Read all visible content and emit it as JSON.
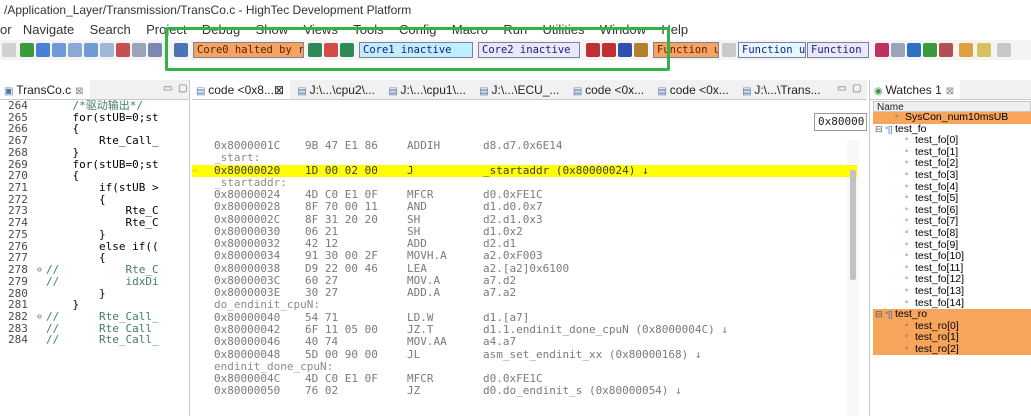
{
  "window": {
    "title": "/Application_Layer/Transmission/TransCo.c - HighTec Development Platform"
  },
  "menu": [
    "or",
    "Navigate",
    "Search",
    "Project",
    "Debug",
    "Show",
    "Views",
    "Tools",
    "Config",
    "Macro",
    "Run",
    "Utilities",
    "Window",
    "Help"
  ],
  "toolbar": {
    "core0": "Core0 halted by re",
    "core1": "Core1 inactive",
    "core2": "Core2 inactive",
    "func1": "Function u",
    "func2": "Function u",
    "func3": "Function u"
  },
  "left_editor": {
    "tab": "TransCo.c",
    "tab_close": "⊠",
    "lines": [
      {
        "n": "264",
        "m": "",
        "c": "    /*驱动输出*/",
        "comment": true
      },
      {
        "n": "265",
        "m": "",
        "c": "    for(stUB=0;st",
        "comment": false
      },
      {
        "n": "266",
        "m": "",
        "c": "    {",
        "comment": false
      },
      {
        "n": "267",
        "m": "",
        "c": "        Rte_Call_",
        "comment": false
      },
      {
        "n": "268",
        "m": "",
        "c": "    }",
        "comment": false
      },
      {
        "n": "269",
        "m": "",
        "c": "    for(stUB=0;st",
        "comment": false
      },
      {
        "n": "270",
        "m": "",
        "c": "    {",
        "comment": false
      },
      {
        "n": "271",
        "m": "",
        "c": "        if(stUB >",
        "comment": false
      },
      {
        "n": "272",
        "m": "",
        "c": "        {",
        "comment": false
      },
      {
        "n": "273",
        "m": "",
        "c": "            Rte_C",
        "comment": false
      },
      {
        "n": "274",
        "m": "",
        "c": "            Rte_C",
        "comment": false
      },
      {
        "n": "275",
        "m": "",
        "c": "        }",
        "comment": false
      },
      {
        "n": "276",
        "m": "",
        "c": "        else if((",
        "comment": false
      },
      {
        "n": "277",
        "m": "",
        "c": "        {",
        "comment": false
      },
      {
        "n": "278",
        "m": "⊖",
        "c": "//          Rte_C",
        "comment": true
      },
      {
        "n": "279",
        "m": "",
        "c": "//          idxDi",
        "comment": true
      },
      {
        "n": "280",
        "m": "",
        "c": "        }",
        "comment": false
      },
      {
        "n": "281",
        "m": "",
        "c": "    }",
        "comment": false
      },
      {
        "n": "282",
        "m": "⊖",
        "c": "//      Rte_Call_",
        "comment": true
      },
      {
        "n": "283",
        "m": "",
        "c": "//      Rte_Call_",
        "comment": true
      },
      {
        "n": "284",
        "m": "",
        "c": "//      Rte_Call_",
        "comment": true
      }
    ]
  },
  "center": {
    "tabs": [
      "code <0x8...",
      "J:\\...\\cpu2\\...",
      "J:\\...\\cpu1\\...",
      "J:\\...\\ECU_...",
      "code <0x...",
      "code <0x...",
      "J:\\...\\Trans..."
    ],
    "address_value": "0x80000",
    "rows": [
      {
        "kind": "ins",
        "a": "0x8000001C",
        "b": "9B 47 E1 86",
        "m": "ADDIH",
        "o": "d8.d7.0x6E14"
      },
      {
        "kind": "label",
        "t": "_start:"
      },
      {
        "kind": "ins",
        "a": "0x80000020",
        "b": "1D 00 02 00",
        "m": "J",
        "o": "_startaddr (0x80000024) ↓",
        "hl": true,
        "g": "⇨"
      },
      {
        "kind": "label",
        "t": "_startaddr:"
      },
      {
        "kind": "ins",
        "a": "0x80000024",
        "b": "4D C0 E1 0F",
        "m": "MFCR",
        "o": "d0.0xFE1C"
      },
      {
        "kind": "ins",
        "a": "0x80000028",
        "b": "8F 70 00 11",
        "m": "AND",
        "o": "d1.d0.0x7"
      },
      {
        "kind": "ins",
        "a": "0x8000002C",
        "b": "8F 31 20 20",
        "m": "SH",
        "o": "d2.d1.0x3"
      },
      {
        "kind": "ins",
        "a": "0x80000030",
        "b": "06 21",
        "m": "SH",
        "o": "d1.0x2"
      },
      {
        "kind": "ins",
        "a": "0x80000032",
        "b": "42 12",
        "m": "ADD",
        "o": "d2.d1"
      },
      {
        "kind": "ins",
        "a": "0x80000034",
        "b": "91 30 00 2F",
        "m": "MOVH.A",
        "o": "a2.0xF003"
      },
      {
        "kind": "ins",
        "a": "0x80000038",
        "b": "D9 22 00 46",
        "m": "LEA",
        "o": "a2.[a2]0x6100"
      },
      {
        "kind": "ins",
        "a": "0x8000003C",
        "b": "60 27",
        "m": "MOV.A",
        "o": "a7.d2"
      },
      {
        "kind": "ins",
        "a": "0x8000003E",
        "b": "30 27",
        "m": "ADD.A",
        "o": "a7.a2"
      },
      {
        "kind": "label",
        "t": "do_endinit_cpuN:"
      },
      {
        "kind": "ins",
        "a": "0x80000040",
        "b": "54 71",
        "m": "LD.W",
        "o": "d1.[a7]"
      },
      {
        "kind": "ins",
        "a": "0x80000042",
        "b": "6F 11 05 00",
        "m": "JZ.T",
        "o": "d1.1.endinit_done_cpuN (0x8000004C) ↓"
      },
      {
        "kind": "ins",
        "a": "0x80000046",
        "b": "40 74",
        "m": "MOV.AA",
        "o": "a4.a7"
      },
      {
        "kind": "ins",
        "a": "0x80000048",
        "b": "5D 00 90 00",
        "m": "JL",
        "o": "asm_set_endinit_xx (0x80000168) ↓"
      },
      {
        "kind": "label",
        "t": "endinit_done_cpuN:"
      },
      {
        "kind": "ins",
        "a": "0x8000004C",
        "b": "4D C0 E1 0F",
        "m": "MFCR",
        "o": "d0.0xFE1C"
      },
      {
        "kind": "ins",
        "a": "0x80000050",
        "b": "76 02",
        "m": "JZ",
        "o": "d0.do_endinit_s (0x80000054) ↓"
      }
    ]
  },
  "watches": {
    "tab": "Watches 1",
    "header": "Name",
    "rows": [
      {
        "t": "SysCon_num10msUB",
        "lvl": 1,
        "exp": "",
        "icon": "ᐤ",
        "hl": true
      },
      {
        "t": "test_fo",
        "lvl": 0,
        "exp": "⊟",
        "icon": "ᐤ[]",
        "hl": false
      },
      {
        "t": "test_fo[0]",
        "lvl": 2,
        "exp": "",
        "icon": "ᐤ",
        "hl": false
      },
      {
        "t": "test_fo[1]",
        "lvl": 2,
        "exp": "",
        "icon": "ᐤ",
        "hl": false
      },
      {
        "t": "test_fo[2]",
        "lvl": 2,
        "exp": "",
        "icon": "ᐤ",
        "hl": false
      },
      {
        "t": "test_fo[3]",
        "lvl": 2,
        "exp": "",
        "icon": "ᐤ",
        "hl": false
      },
      {
        "t": "test_fo[4]",
        "lvl": 2,
        "exp": "",
        "icon": "ᐤ",
        "hl": false
      },
      {
        "t": "test_fo[5]",
        "lvl": 2,
        "exp": "",
        "icon": "ᐤ",
        "hl": false
      },
      {
        "t": "test_fo[6]",
        "lvl": 2,
        "exp": "",
        "icon": "ᐤ",
        "hl": false
      },
      {
        "t": "test_fo[7]",
        "lvl": 2,
        "exp": "",
        "icon": "ᐤ",
        "hl": false
      },
      {
        "t": "test_fo[8]",
        "lvl": 2,
        "exp": "",
        "icon": "ᐤ",
        "hl": false
      },
      {
        "t": "test_fo[9]",
        "lvl": 2,
        "exp": "",
        "icon": "ᐤ",
        "hl": false
      },
      {
        "t": "test_fo[10]",
        "lvl": 2,
        "exp": "",
        "icon": "ᐤ",
        "hl": false
      },
      {
        "t": "test_fo[11]",
        "lvl": 2,
        "exp": "",
        "icon": "ᐤ",
        "hl": false
      },
      {
        "t": "test_fo[12]",
        "lvl": 2,
        "exp": "",
        "icon": "ᐤ",
        "hl": false
      },
      {
        "t": "test_fo[13]",
        "lvl": 2,
        "exp": "",
        "icon": "ᐤ",
        "hl": false
      },
      {
        "t": "test_fo[14]",
        "lvl": 2,
        "exp": "",
        "icon": "ᐤ",
        "hl": false
      },
      {
        "t": "test_ro",
        "lvl": 0,
        "exp": "⊟",
        "icon": "ᐤ[]",
        "hl": true
      },
      {
        "t": "test_ro[0]",
        "lvl": 2,
        "exp": "",
        "icon": "ᐤ",
        "hl": true
      },
      {
        "t": "test_ro[1]",
        "lvl": 2,
        "exp": "",
        "icon": "ᐤ",
        "hl": true
      },
      {
        "t": "test_ro[2]",
        "lvl": 2,
        "exp": "",
        "icon": "ᐤ",
        "hl": true
      }
    ]
  },
  "colors": {
    "highlight_box": "#33b249",
    "current_line": "#ffff00",
    "watch_highlight": "#f8a55c",
    "core0_bg": "#f4a460",
    "core1_bg": "#bfefff",
    "core2_bg": "#e8e8f8",
    "func_bg": "#f4a460"
  }
}
